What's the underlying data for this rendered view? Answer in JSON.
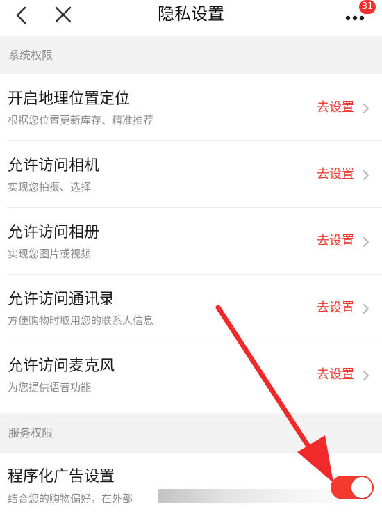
{
  "nav": {
    "title": "隐私设置",
    "badge_count": "31",
    "icons": [
      "back-arrow-icon",
      "close-icon",
      "more-icon"
    ]
  },
  "sections": {
    "system": {
      "label": "系统权限"
    },
    "service": {
      "label": "服务权限"
    }
  },
  "rows": [
    {
      "title": "开启地理位置定位",
      "subtitle": "根据您位置更新库存、精准推荐",
      "action": "去设置"
    },
    {
      "title": "允许访问相机",
      "subtitle": "实现您拍摄、选择",
      "action": "去设置"
    },
    {
      "title": "允许访问相册",
      "subtitle": "实现您图片或视频",
      "action": "去设置"
    },
    {
      "title": "允许访问通讯录",
      "subtitle": "方便购物时取用您的联系人信息",
      "action": "去设置"
    },
    {
      "title": "允许访问麦克风",
      "subtitle": "为您提供语音功能",
      "action": "去设置"
    }
  ],
  "ad_setting": {
    "title": "程序化广告设置",
    "subtitle": "结合您的购物偏好，在外部",
    "enabled": true
  },
  "colors": {
    "accent": "#ee3b2f",
    "section_bg": "#f2f2f2",
    "annotation_arrow": "#f02a2a"
  }
}
